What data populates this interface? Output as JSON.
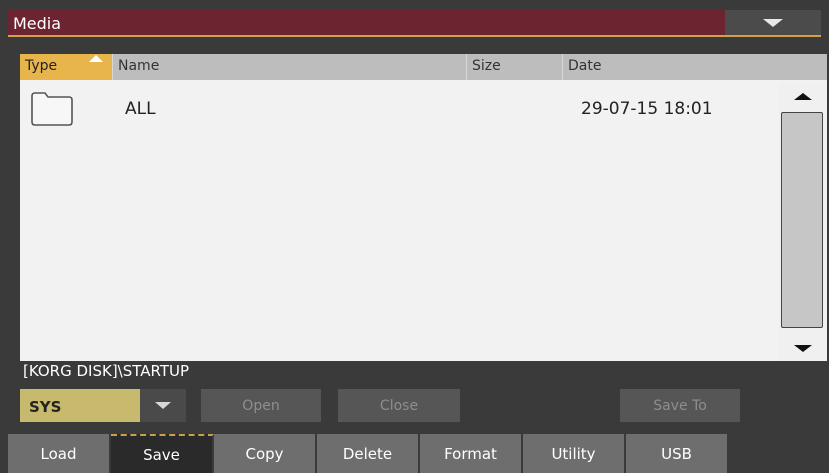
{
  "window": {
    "title": "Media"
  },
  "columns": {
    "type": "Type",
    "name": "Name",
    "size": "Size",
    "date": "Date"
  },
  "files": [
    {
      "icon": "folder-icon",
      "name": "ALL",
      "size": "",
      "date": "29-07-15 18:01"
    }
  ],
  "path": "[KORG DISK]\\STARTUP",
  "device_select": {
    "value": "SYS"
  },
  "buttons": {
    "open": "Open",
    "close": "Close",
    "save_to": "Save To"
  },
  "tabs": [
    {
      "label": "Load",
      "active": false
    },
    {
      "label": "Save",
      "active": true
    },
    {
      "label": "Copy",
      "active": false
    },
    {
      "label": "Delete",
      "active": false
    },
    {
      "label": "Format",
      "active": false
    },
    {
      "label": "Utility",
      "active": false
    },
    {
      "label": "USB",
      "active": false
    }
  ],
  "colors": {
    "title_bar": "#6b2430",
    "sorted_column": "#e8b54c",
    "device_select": "#c8ba6c"
  }
}
